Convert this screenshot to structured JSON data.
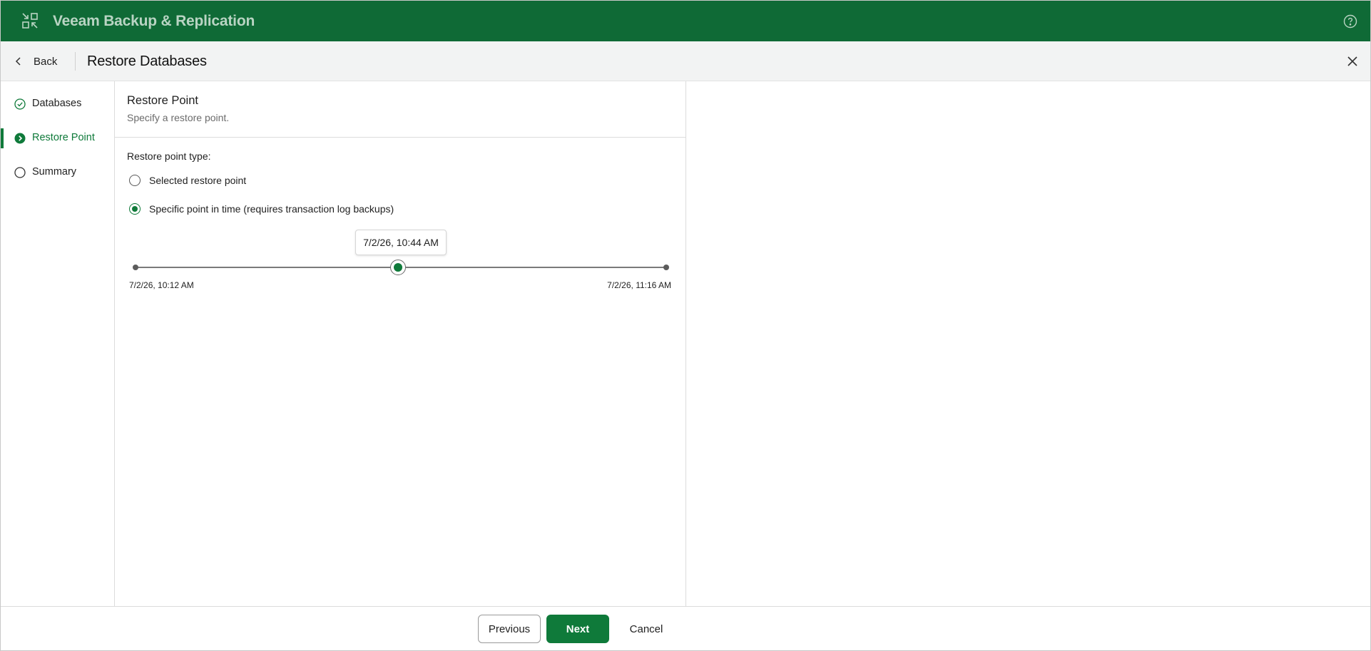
{
  "app": {
    "title": "Veeam Backup & Replication",
    "logo_icon": "veeam-logo-icon",
    "help_icon": "help-circle-icon",
    "brand_color": "#0f6a36",
    "accent_color": "#0f7a3a"
  },
  "header": {
    "back_label": "Back",
    "title": "Restore Databases",
    "close_icon": "close-icon"
  },
  "steps": [
    {
      "label": "Databases",
      "state": "completed",
      "icon": "check-circle-icon"
    },
    {
      "label": "Restore Point",
      "state": "active",
      "icon": "chevron-right-circle-icon"
    },
    {
      "label": "Summary",
      "state": "pending",
      "icon": "empty-circle-icon"
    }
  ],
  "section": {
    "title": "Restore Point",
    "subtitle": "Specify a restore point."
  },
  "restore_point": {
    "type_label": "Restore point type:",
    "options": [
      {
        "label": "Selected restore point",
        "checked": false
      },
      {
        "label": "Specific point in time (requires transaction log backups)",
        "checked": true
      }
    ]
  },
  "slider": {
    "start_label": "7/2/26, 10:12 AM",
    "end_label": "7/2/26, 11:16 AM",
    "current_label": "7/2/26, 10:44 AM",
    "position_fraction": 0.5
  },
  "footer": {
    "previous_label": "Previous",
    "next_label": "Next",
    "cancel_label": "Cancel"
  }
}
